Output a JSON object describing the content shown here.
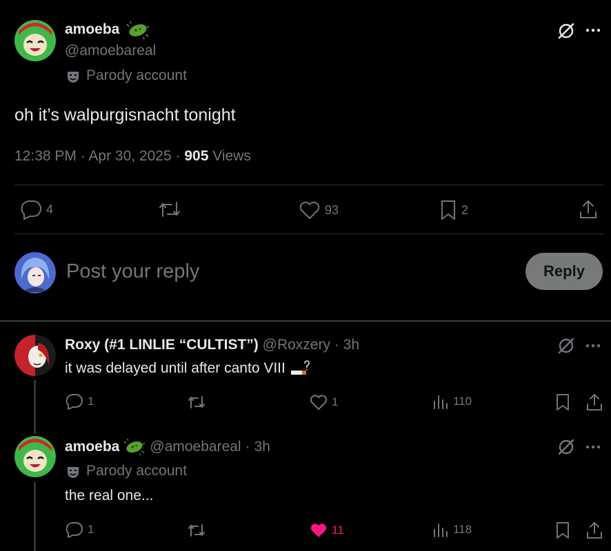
{
  "main_post": {
    "author_name": "amoeba",
    "handle": "@amoebareal",
    "account_label": "Parody account",
    "text": "oh it’s walpurgisnacht tonight",
    "time": "12:38 PM",
    "date": "Apr 30, 2025",
    "views_count": "905",
    "views_label": "Views",
    "replies": "4",
    "likes": "93",
    "bookmarks": "2"
  },
  "composer": {
    "placeholder": "Post your reply",
    "button_label": "Reply"
  },
  "replies": [
    {
      "author_name": "Roxy (#1 LINLIE “CULTIST”)",
      "handle": "@Roxzery",
      "time": "3h",
      "text": "it was delayed until after canto VIII",
      "replies": "1",
      "likes": "1",
      "views": "110"
    },
    {
      "author_name": "amoeba",
      "handle": "@amoebareal",
      "time": "3h",
      "account_label": "Parody account",
      "text": "the real one...",
      "replies": "1",
      "likes": "11",
      "views": "118"
    }
  ],
  "colors": {
    "background": "#000000",
    "text": "#e7e9ea",
    "muted": "#71767b",
    "liked": "#f91880",
    "divider": "#2f3336"
  }
}
